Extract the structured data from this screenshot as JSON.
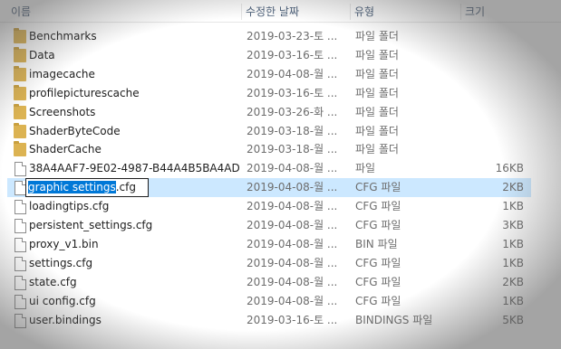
{
  "columns": {
    "name": "이름",
    "date": "수정한 날짜",
    "type": "유형",
    "size": "크기"
  },
  "rows": [
    {
      "name": "Benchmarks",
      "date": "2019-03-23-토 ...",
      "type": "파일 폴더",
      "size": "",
      "icon": "folder-icon"
    },
    {
      "name": "Data",
      "date": "2019-03-16-토 ...",
      "type": "파일 폴더",
      "size": "",
      "icon": "folder-icon"
    },
    {
      "name": "imagecache",
      "date": "2019-04-08-월 ...",
      "type": "파일 폴더",
      "size": "",
      "icon": "folder-icon"
    },
    {
      "name": "profilepicturescache",
      "date": "2019-03-16-토 ...",
      "type": "파일 폴더",
      "size": "",
      "icon": "folder-icon"
    },
    {
      "name": "Screenshots",
      "date": "2019-03-26-화 ...",
      "type": "파일 폴더",
      "size": "",
      "icon": "folder-icon"
    },
    {
      "name": "ShaderByteCode",
      "date": "2019-03-18-월 ...",
      "type": "파일 폴더",
      "size": "",
      "icon": "folder-icon"
    },
    {
      "name": "ShaderCache",
      "date": "2019-03-18-월 ...",
      "type": "파일 폴더",
      "size": "",
      "icon": "folder-icon"
    },
    {
      "name": "38A4AAF7-9E02-4987-B44A4B5BA4AD...",
      "date": "2019-04-08-월 ...",
      "type": "파일",
      "size": "16KB",
      "icon": "file-icon"
    },
    {
      "name": "graphic settings.cfg",
      "date": "2019-04-08-월 ...",
      "type": "CFG 파일",
      "size": "2KB",
      "icon": "file-icon",
      "selected": true,
      "rename_sel": "graphic settings",
      "rename_ext": ".cfg"
    },
    {
      "name": "loadingtips.cfg",
      "date": "2019-04-08-월 ...",
      "type": "CFG 파일",
      "size": "1KB",
      "icon": "file-icon"
    },
    {
      "name": "persistent_settings.cfg",
      "date": "2019-04-08-월 ...",
      "type": "CFG 파일",
      "size": "3KB",
      "icon": "file-icon"
    },
    {
      "name": "proxy_v1.bin",
      "date": "2019-04-08-월 ...",
      "type": "BIN 파일",
      "size": "1KB",
      "icon": "file-icon"
    },
    {
      "name": "settings.cfg",
      "date": "2019-04-08-월 ...",
      "type": "CFG 파일",
      "size": "1KB",
      "icon": "file-icon"
    },
    {
      "name": "state.cfg",
      "date": "2019-04-08-월 ...",
      "type": "CFG 파일",
      "size": "2KB",
      "icon": "file-icon"
    },
    {
      "name": "ui config.cfg",
      "date": "2019-04-08-월 ...",
      "type": "CFG 파일",
      "size": "1KB",
      "icon": "file-icon"
    },
    {
      "name": "user.bindings",
      "date": "2019-03-16-토 ...",
      "type": "BINDINGS 파일",
      "size": "5KB",
      "icon": "file-icon"
    }
  ]
}
